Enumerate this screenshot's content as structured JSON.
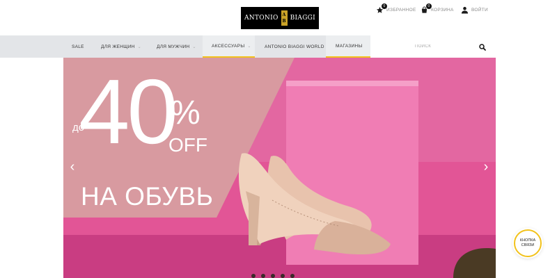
{
  "brand": {
    "logo_left": "ANTONIO",
    "logo_right": "BIAGGI",
    "monogram_top": "A",
    "monogram_bottom": "B"
  },
  "header": {
    "favorites": {
      "label": "ИЗБРАННОЕ",
      "count": "0",
      "icon": "star-icon"
    },
    "cart": {
      "label": "КОРЗИНА",
      "count": "0",
      "icon": "cart-icon"
    },
    "login": {
      "label": "ВОЙТИ",
      "icon": "user-icon"
    }
  },
  "nav": {
    "items": [
      {
        "label": "SALE"
      },
      {
        "label": "ДЛЯ ЖЕНЩИН",
        "dropdown": true
      },
      {
        "label": "ДЛЯ МУЖЧИН",
        "dropdown": true
      },
      {
        "label": "АКСЕССУАРЫ",
        "dropdown": true,
        "active": true
      },
      {
        "label": "ANTONIO BIAGGI WORLD"
      },
      {
        "label": "МАГАЗИНЫ"
      }
    ],
    "chevron": "⌄"
  },
  "search": {
    "placeholder": "ПОИСК",
    "icon": "search-icon"
  },
  "banner": {
    "prefix": "до",
    "number": "40",
    "percent": "%",
    "off": "OFF",
    "text": "НА ОБУВЬ",
    "prev": "‹",
    "next": "›",
    "slides": 5,
    "colors": {
      "background": "#e25596",
      "overlay": "#d89aa0",
      "box": "#f07db4",
      "shoe": "#e8c3ad"
    }
  },
  "contact": {
    "line1": "КНОПКА",
    "line2": "СВЯЗИ"
  },
  "colors": {
    "accent": "#f2c21b",
    "nav_bg": "#e3e5e8"
  }
}
